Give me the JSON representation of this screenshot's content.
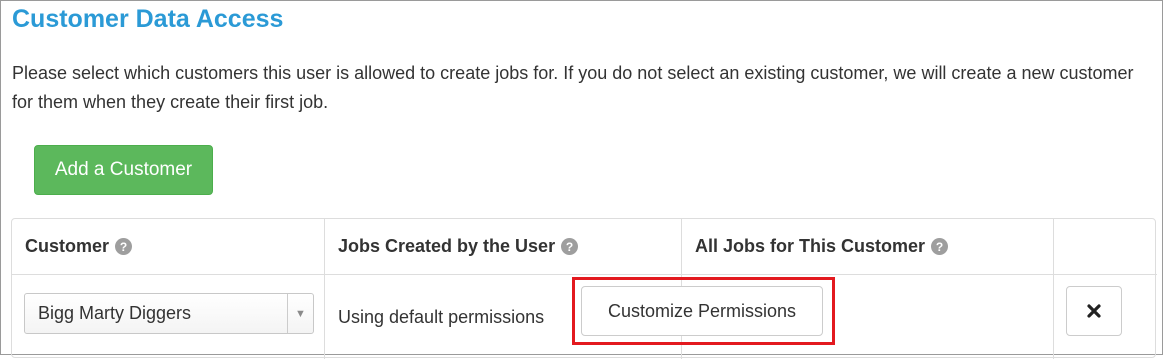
{
  "section": {
    "title": "Customer Data Access",
    "description": "Please select which customers this user is allowed to create jobs for. If you do not select an existing customer, we will create a new customer for them when they create their first job."
  },
  "add_button": {
    "label": "Add a Customer"
  },
  "table": {
    "headers": [
      {
        "label": "Customer",
        "help_icon": "question-circle-icon"
      },
      {
        "label": "Jobs Created by the User",
        "help_icon": "question-circle-icon"
      },
      {
        "label": "All Jobs for This Customer",
        "help_icon": "question-circle-icon"
      },
      {
        "label": ""
      }
    ],
    "rows": [
      {
        "customer_select": "Bigg Marty Diggers",
        "jobs_created_text": "Using default permissions",
        "customize_label": "Customize Permissions",
        "remove_icon": "close-icon"
      }
    ]
  },
  "colors": {
    "title": "#2b9ad6",
    "add_button": "#5cb85c",
    "highlight": "#e3191f",
    "help_icon": "#9e9e9e"
  }
}
